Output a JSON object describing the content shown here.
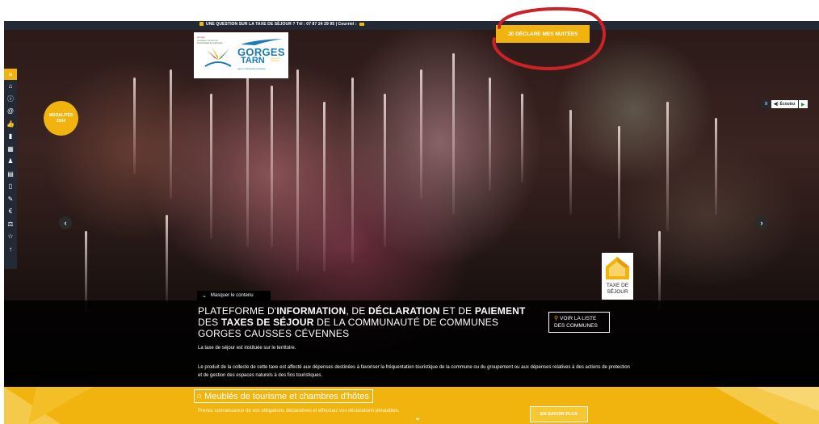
{
  "topbar": {
    "text": "UNE QUESTION SUR LA TAXE DE SÉJOUR ? Tél : 07 87 24 29 95 | Courriel :"
  },
  "logo": {
    "left_line1": "Gorges",
    "left_line2": "Causses Cévennes",
    "left_line3": "Communauté de communes",
    "brand_top": "GORGES",
    "brand_bottom": "TARN",
    "brand_small": "Causses & Cévennes",
    "brand_foot": "Agence d'attractivité touristique"
  },
  "cta": {
    "label": "JE DÉCLARE MES NUITÉES"
  },
  "badge": {
    "line1": "MODALITÉS",
    "line2": "2024"
  },
  "listen": {
    "label": "Écoutez"
  },
  "sidebar": {
    "icons": [
      "menu-icon",
      "home-icon",
      "info-icon",
      "at-icon",
      "thumbs-up-icon",
      "document-icon",
      "calendar-icon",
      "user-icon",
      "calculator-icon",
      "file-icon",
      "pencil-icon",
      "euro-icon",
      "scale-icon",
      "star-icon",
      "arrow-up-icon"
    ]
  },
  "taxe_logo": {
    "line1": "TAXE DE",
    "line2": "SÉJOUR"
  },
  "content": {
    "toggle_label": "Masquer le contenu",
    "headline_parts": {
      "p1": "PLATEFORME D'",
      "b1": "INFORMATION",
      "p2": ", DE ",
      "b2": "DÉCLARATION",
      "p3": " ET DE ",
      "b3": "PAIEMENT",
      "p4": " DES ",
      "b4": "TAXES DE SÉJOUR",
      "p5": " DE LA COMMUNAUTÉ DE COMMUNES GORGES CAUSSES CÉVENNES"
    },
    "para1": "La taxe de séjour est instituée sur le territoire.",
    "para2": "Le produit de la collecte de cette taxe est affecté aux dépenses destinées à favoriser la fréquentation touristique de la commune ou du groupement ou aux dépenses relatives à des actions de protection et de gestion des espaces naturels à des fins touristiques.",
    "voir_line1": "VOIR LA LISTE",
    "voir_line2": "DES COMMUNES"
  },
  "band": {
    "title": "Meublés de tourisme et chambres d'hôtes",
    "text": "Prenez connaissance de vos obligations déclaratives et effectuez vos déclarations préalables.",
    "button": "EN SAVOIR PLUS"
  },
  "colors": {
    "accent": "#f1b40e",
    "navy": "#232a36",
    "annotation": "#cc2127"
  }
}
